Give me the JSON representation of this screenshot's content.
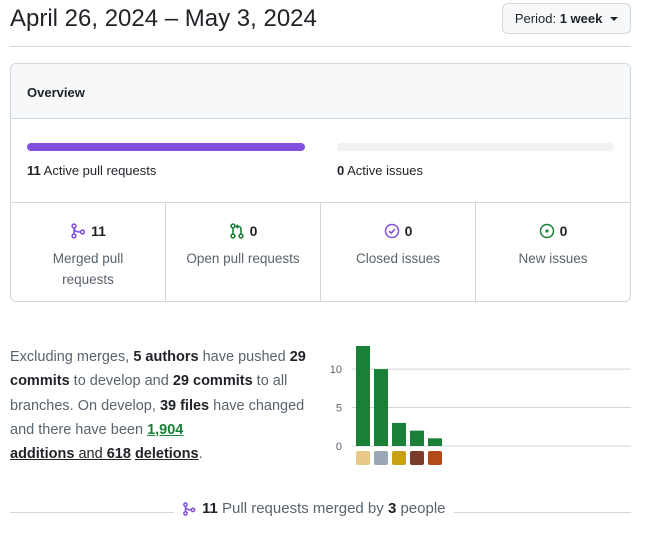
{
  "header": {
    "date_range": "April 26, 2024 – May 3, 2024",
    "period_label": "Period:",
    "period_value": "1 week"
  },
  "overview": {
    "title": "Overview",
    "active_pull_requests": {
      "count": "11",
      "label": "Active pull requests",
      "fill_percent": 100
    },
    "active_issues": {
      "count": "0",
      "label": "Active issues",
      "fill_percent": 0
    },
    "stats": [
      {
        "count": "11",
        "label": "Merged pull requests",
        "icon": "git-merge-icon",
        "color": "#8250df"
      },
      {
        "count": "0",
        "label": "Open pull requests",
        "icon": "git-pull-request-icon",
        "color": "#1a7f37"
      },
      {
        "count": "0",
        "label": "Closed issues",
        "icon": "issue-closed-icon",
        "color": "#8250df"
      },
      {
        "count": "0",
        "label": "New issues",
        "icon": "issue-opened-icon",
        "color": "#1a7f37"
      }
    ]
  },
  "summary": {
    "t1": "Excluding merges, ",
    "authors": "5 authors",
    "t2": " have pushed ",
    "commits_develop": "29 commits",
    "t3": " to develop and ",
    "commits_all": "29 commits",
    "t4": " to all branches. On develop, ",
    "files": "39 files",
    "t5": " have changed and there have been ",
    "additions_count": "1,904",
    "additions_word": "additions",
    "t6": " and ",
    "deletions_count": "618",
    "deletions_word": "deletions",
    "t7": "."
  },
  "chart_data": {
    "type": "bar",
    "categories": [
      "author-1",
      "author-2",
      "author-3",
      "author-4",
      "author-5"
    ],
    "values": [
      13,
      10,
      3,
      2,
      1
    ],
    "yticks": [
      0,
      5,
      10
    ],
    "ylim": [
      0,
      13
    ],
    "bar_color": "#1a7f37"
  },
  "footer": {
    "merged_count": "11",
    "merged_text": "Pull requests merged by",
    "people_count": "3",
    "people_text": "people"
  }
}
